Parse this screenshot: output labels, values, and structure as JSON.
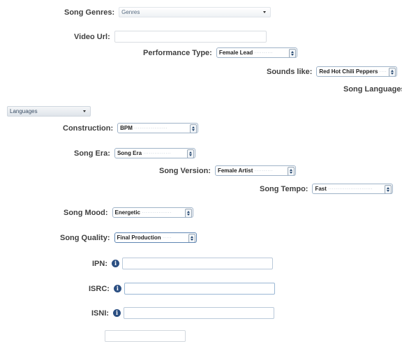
{
  "fields": {
    "genres": {
      "label": "Song Genres:",
      "value": "Genres"
    },
    "video_url": {
      "label": "Video Url:",
      "value": ""
    },
    "performance_type": {
      "label": "Performance Type:",
      "value": "Female Lead"
    },
    "sounds_like": {
      "label": "Sounds like:",
      "value": "Red Hot Chili Peppers"
    },
    "song_languages": {
      "label": "Song Languages:",
      "value": "Languages"
    },
    "construction": {
      "label": "Construction:",
      "value": "BPM"
    },
    "song_era": {
      "label": "Song Era:",
      "value": "Song Era"
    },
    "song_version": {
      "label": "Song Version:",
      "value": "Female Artist"
    },
    "song_tempo": {
      "label": "Song Tempo:",
      "value": "Fast"
    },
    "song_mood": {
      "label": "Song Mood:",
      "value": "Energetic"
    },
    "song_quality": {
      "label": "Song Quality:",
      "value": "Final Production"
    },
    "ipn": {
      "label": "IPN:",
      "value": ""
    },
    "isrc": {
      "label": "ISRC:",
      "value": ""
    },
    "isni": {
      "label": "ISNI:",
      "value": ""
    }
  },
  "icons": {
    "info": "i"
  },
  "colors": {
    "accent": "#2b4f82",
    "field_border": "#9fb3c8"
  }
}
